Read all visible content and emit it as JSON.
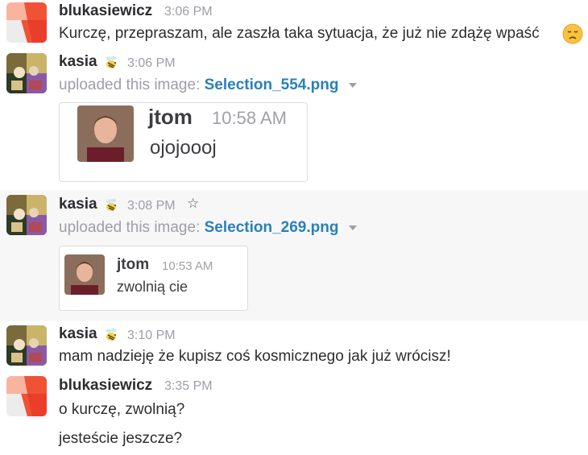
{
  "messages": [
    {
      "author": "blukasiewicz",
      "time": "3:06 PM",
      "text": "Kurczę, przepraszam, ale zaszła taka sytuacja, że już nie zdążę wpaść",
      "emoji": "disappointed-face"
    },
    {
      "author": "kasia",
      "time": "3:06 PM",
      "badge": "bee-icon",
      "upload_prefix": "uploaded this image:",
      "file_name": "Selection_554.png",
      "preview": {
        "name": "jtom",
        "time": "10:58 AM",
        "text": "ojojoooj"
      }
    },
    {
      "author": "kasia",
      "time": "3:08 PM",
      "badge": "bee-icon",
      "upload_prefix": "uploaded this image:",
      "file_name": "Selection_269.png",
      "preview": {
        "name": "jtom",
        "time": "10:53 AM",
        "text": "zwolnią cie"
      }
    },
    {
      "author": "kasia",
      "time": "3:10 PM",
      "badge": "bee-icon",
      "text": "mam nadzieję że kupisz coś kosmicznego jak już wrócisz!"
    },
    {
      "author": "blukasiewicz",
      "time": "3:35 PM",
      "lines": [
        "o kurczę, zwolnią?",
        "jesteście jeszcze?"
      ]
    }
  ],
  "colors": {
    "link": "#2a80b9",
    "hover_bg": "#f7f7f7",
    "timestamp": "#9e9ea6"
  }
}
